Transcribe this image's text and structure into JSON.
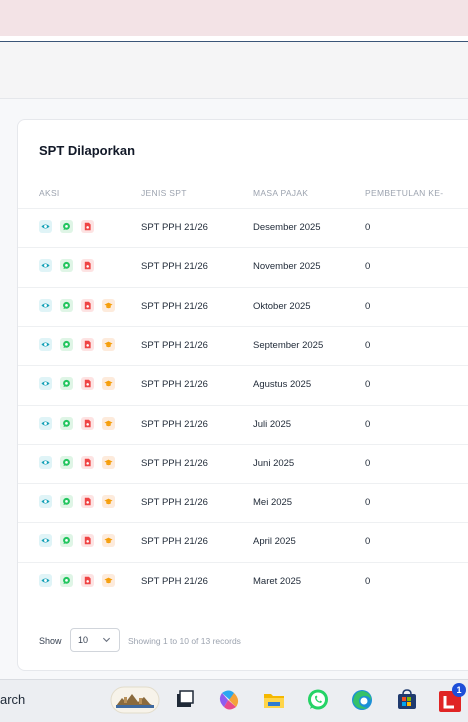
{
  "card": {
    "title": "SPT Dilaporkan"
  },
  "table": {
    "headers": [
      "AKSI",
      "JENIS SPT",
      "MASA PAJAK",
      "PEMBETULAN KE-"
    ],
    "rows": [
      {
        "jenis": "SPT PPH 21/26",
        "masa": "Desember 2025",
        "pembetulan": "0",
        "actions": [
          "view-icon",
          "whatsapp-icon",
          "pdf-icon"
        ]
      },
      {
        "jenis": "SPT PPH 21/26",
        "masa": "November 2025",
        "pembetulan": "0",
        "actions": [
          "view-icon",
          "whatsapp-icon",
          "pdf-icon"
        ]
      },
      {
        "jenis": "SPT PPH 21/26",
        "masa": "Oktober 2025",
        "pembetulan": "0",
        "actions": [
          "view-icon",
          "whatsapp-icon",
          "pdf-icon",
          "graduation-cap-icon"
        ]
      },
      {
        "jenis": "SPT PPH 21/26",
        "masa": "September 2025",
        "pembetulan": "0",
        "actions": [
          "view-icon",
          "whatsapp-icon",
          "pdf-icon",
          "graduation-cap-icon"
        ]
      },
      {
        "jenis": "SPT PPH 21/26",
        "masa": "Agustus 2025",
        "pembetulan": "0",
        "actions": [
          "view-icon",
          "whatsapp-icon",
          "pdf-icon",
          "graduation-cap-icon"
        ]
      },
      {
        "jenis": "SPT PPH 21/26",
        "masa": "Juli 2025",
        "pembetulan": "0",
        "actions": [
          "view-icon",
          "whatsapp-icon",
          "pdf-icon",
          "graduation-cap-icon"
        ]
      },
      {
        "jenis": "SPT PPH 21/26",
        "masa": "Juni 2025",
        "pembetulan": "0",
        "actions": [
          "view-icon",
          "whatsapp-icon",
          "pdf-icon",
          "graduation-cap-icon"
        ]
      },
      {
        "jenis": "SPT PPH 21/26",
        "masa": "Mei 2025",
        "pembetulan": "0",
        "actions": [
          "view-icon",
          "whatsapp-icon",
          "pdf-icon",
          "graduation-cap-icon"
        ]
      },
      {
        "jenis": "SPT PPH 21/26",
        "masa": "April 2025",
        "pembetulan": "0",
        "actions": [
          "view-icon",
          "whatsapp-icon",
          "pdf-icon",
          "graduation-cap-icon"
        ]
      },
      {
        "jenis": "SPT PPH 21/26",
        "masa": "Maret 2025",
        "pembetulan": "0",
        "actions": [
          "view-icon",
          "whatsapp-icon",
          "pdf-icon",
          "graduation-cap-icon"
        ]
      }
    ]
  },
  "footer": {
    "show_label": "Show",
    "page_size": "10",
    "records_text": "Showing 1 to 10 of 13 records"
  },
  "taskbar": {
    "search_text": "arch",
    "icons": [
      "search-highlight-icon",
      "task-view-icon",
      "copilot-icon",
      "file-explorer-icon",
      "whatsapp-icon",
      "edge-icon",
      "store-icon",
      "app-l-icon"
    ],
    "badge": "1"
  },
  "colors": {
    "view": "#17a2b8",
    "whatsapp": "#22c55e",
    "pdf": "#ef4444",
    "education": "#f59e0b",
    "top_band": "#f3e3e6"
  }
}
